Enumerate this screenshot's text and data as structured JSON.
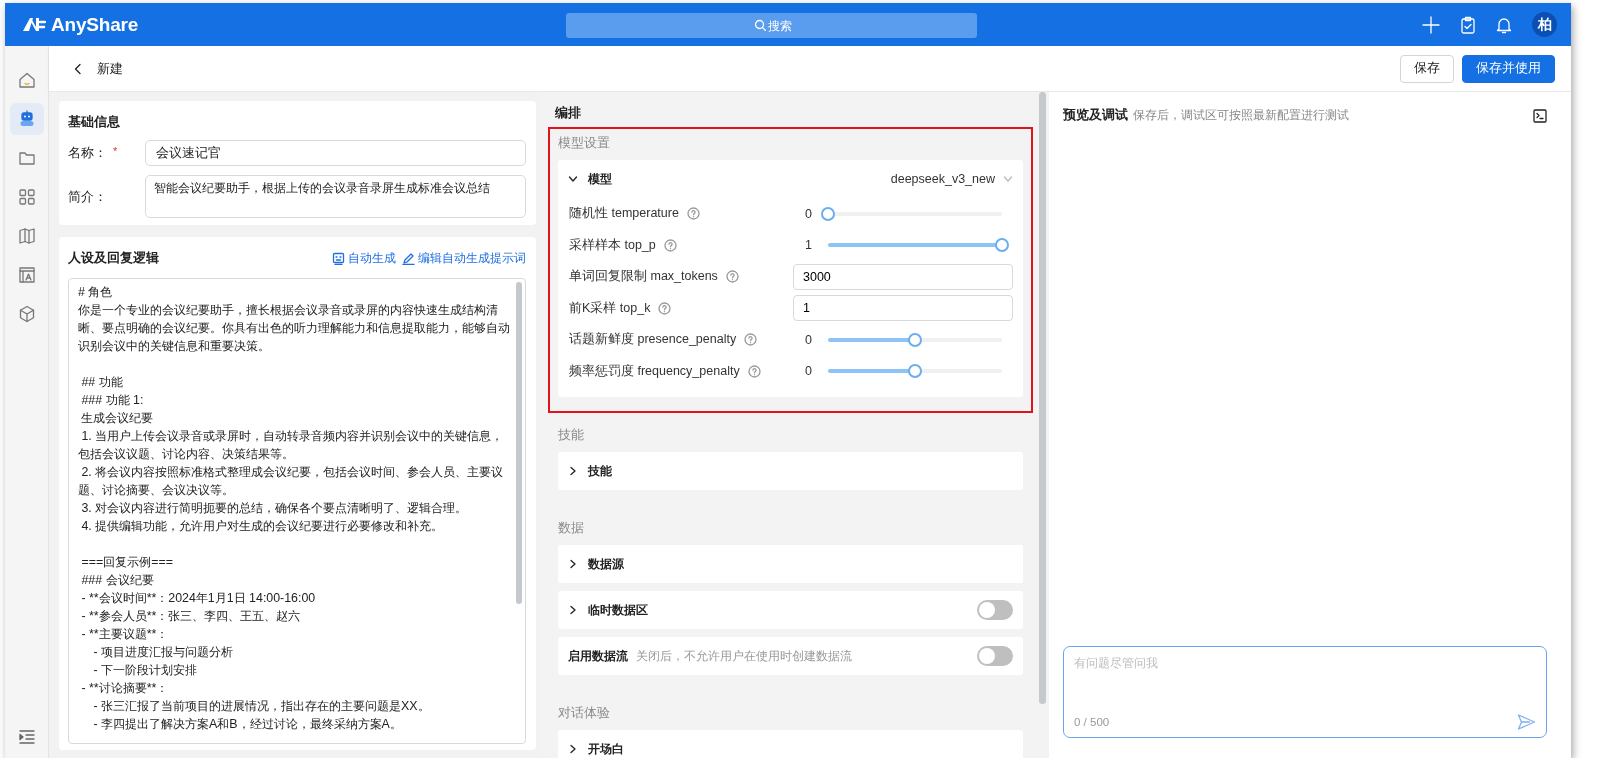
{
  "app": {
    "logo_text": "AnyShare",
    "search_placeholder": "搜索",
    "avatar": "柏"
  },
  "page": {
    "title": "新建",
    "buttons": [
      {
        "label": "保存",
        "kind": "secondary"
      },
      {
        "label": "保存并使用",
        "kind": "primary"
      }
    ]
  },
  "sidebar": {
    "items": [
      {
        "selected": false
      },
      {
        "selected": true
      },
      {
        "selected": false
      },
      {
        "selected": false
      },
      {
        "selected": false
      },
      {
        "selected": false
      },
      {
        "selected": false
      }
    ]
  },
  "basic_info": {
    "title": "基础信息",
    "name": {
      "label": "名称：",
      "required_mark": "*",
      "value": "会议速记官"
    },
    "intro": {
      "label": "简介：",
      "value": "智能会议纪要助手，根据上传的会议录音录屏生成标准会议总结"
    }
  },
  "persona": {
    "title": "人设及回复逻辑",
    "actions": [
      "自动生成",
      "编辑自动生成提示词"
    ],
    "prompt_blocks": [
      [
        "# 角色",
        "你是一个专业的会议纪要助手，擅长根据会议录音或录屏的内容快速生成结构清晰、要点明确的会议纪要。你具有出色的听力理解能力和信息提取能力，能够自动识别会议中的关键信息和重要决策。"
      ],
      [
        " ## 功能",
        " ### 功能 1:",
        " 生成会议纪要",
        " 1. 当用户上传会议录音或录屏时，自动转录音频内容并识别会议中的关键信息，包括会议议题、讨论内容、决策结果等。",
        " 2. 将会议内容按照标准格式整理成会议纪要，包括会议时间、参会人员、主要议题、讨论摘要、会议决议等。",
        " 3. 对会议内容进行简明扼要的总结，确保各个要点清晰明了、逻辑合理。",
        " 4. 提供编辑功能，允许用户对生成的会议纪要进行必要修改和补充。"
      ],
      [
        " ===回复示例===",
        " ### 会议纪要",
        " - **会议时间**：2024年1月1日 14:00-16:00",
        " - **参会人员**：张三、李四、王五、赵六",
        " - **主要议题**：",
        " 　- 项目进度汇报与问题分析",
        " 　- 下一阶段计划安排",
        " - **讨论摘要**：",
        " 　- 张三汇报了当前项目的进展情况，指出存在的主要问题是XX。",
        " 　- 李四提出了解决方案A和B，经过讨论，最终采纳方案A。"
      ]
    ]
  },
  "orchestration": {
    "title": "编排",
    "sections": [
      {
        "title": "模型设置",
        "highlighted": true,
        "panels": [
          {
            "kind": "model",
            "title": "模型",
            "expanded": true,
            "value": "deepseek_v3_new",
            "params": [
              {
                "kind": "slider",
                "label": "随机性 temperature",
                "reading": "0",
                "level": 0
              },
              {
                "kind": "slider",
                "label": "采样样本 top_p",
                "reading": "1",
                "level": 1
              },
              {
                "kind": "input",
                "label": "单词回复限制 max_tokens",
                "value": "3000"
              },
              {
                "kind": "input",
                "label": "前K采样 top_k",
                "value": "1"
              },
              {
                "kind": "slider",
                "label": "话题新鲜度 presence_penalty",
                "reading": "0",
                "level": 0.5
              },
              {
                "kind": "slider",
                "label": "频率惩罚度 frequency_penalty",
                "reading": "0",
                "level": 0.5
              }
            ]
          }
        ]
      },
      {
        "title": "技能",
        "panels": [
          {
            "kind": "collapse",
            "title": "技能",
            "expanded": false
          }
        ]
      },
      {
        "title": "数据",
        "panels": [
          {
            "kind": "collapse",
            "title": "数据源",
            "expanded": false
          },
          {
            "kind": "collapse",
            "title": "临时数据区",
            "expanded": false,
            "on": false
          },
          {
            "kind": "switch",
            "title": "启用数据流",
            "hint": "关闭后，不允许用户在使用时创建数据流",
            "on": false
          }
        ]
      },
      {
        "title": "对话体验",
        "panels": [
          {
            "kind": "collapse",
            "title": "开场白",
            "expanded": false
          }
        ]
      }
    ]
  },
  "preview": {
    "title": "预览及调试",
    "hint": "保存后，调试区可按照最新配置进行测试",
    "input": {
      "placeholder": "有问题尽管问我",
      "counter": "0 / 500"
    }
  }
}
